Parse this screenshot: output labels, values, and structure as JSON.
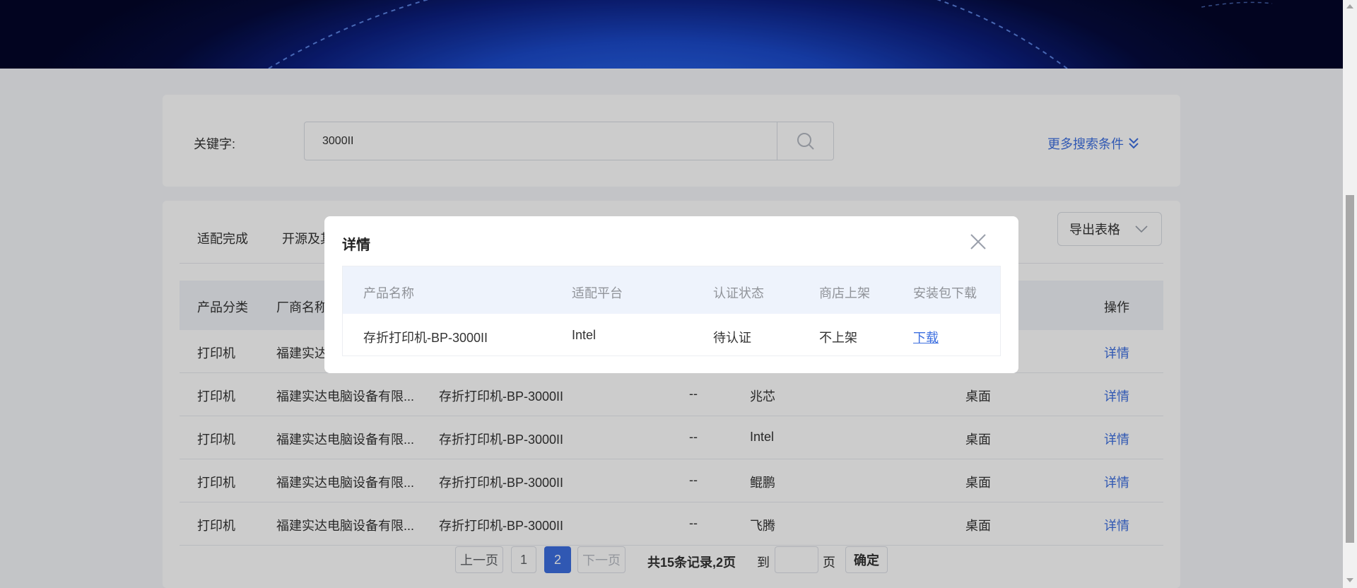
{
  "search": {
    "keyword_label": "关键字:",
    "keyword_value": "3000II",
    "more_conditions": "更多搜索条件"
  },
  "tabs": [
    "适配完成",
    "开源及其"
  ],
  "export": {
    "label": "导出表格"
  },
  "table": {
    "headers": {
      "category": "产品分类",
      "vendor": "厂商名称",
      "action": "操作"
    },
    "rows": [
      {
        "category": "打印机",
        "vendor": "福建实达",
        "product": "",
        "version": "",
        "platform": "",
        "type": "",
        "action": "详情"
      },
      {
        "category": "打印机",
        "vendor": "福建实达电脑设备有限...",
        "product": "存折打印机-BP-3000II",
        "version": "--",
        "platform": "兆芯",
        "type": "桌面",
        "action": "详情"
      },
      {
        "category": "打印机",
        "vendor": "福建实达电脑设备有限...",
        "product": "存折打印机-BP-3000II",
        "version": "--",
        "platform": "Intel",
        "type": "桌面",
        "action": "详情"
      },
      {
        "category": "打印机",
        "vendor": "福建实达电脑设备有限...",
        "product": "存折打印机-BP-3000II",
        "version": "--",
        "platform": "鲲鹏",
        "type": "桌面",
        "action": "详情"
      },
      {
        "category": "打印机",
        "vendor": "福建实达电脑设备有限...",
        "product": "存折打印机-BP-3000II",
        "version": "--",
        "platform": "飞腾",
        "type": "桌面",
        "action": "详情"
      }
    ]
  },
  "pagination": {
    "prev": "上一页",
    "pages": [
      "1",
      "2"
    ],
    "current": "2",
    "next": "下一页",
    "summary": "共15条记录,2页",
    "goto_label": "到",
    "page_unit": "页",
    "confirm": "确定"
  },
  "modal": {
    "title": "详情",
    "headers": {
      "product": "产品名称",
      "platform": "适配平台",
      "cert_status": "认证状态",
      "store": "商店上架",
      "download": "安装包下载"
    },
    "row": {
      "product": "存折打印机-BP-3000II",
      "platform": "Intel",
      "cert_status": "待认证",
      "store": "不上架",
      "download": "下载"
    }
  },
  "colors": {
    "accent": "#3d6fe0",
    "overlay": "rgba(0,0,0,0.2)"
  }
}
